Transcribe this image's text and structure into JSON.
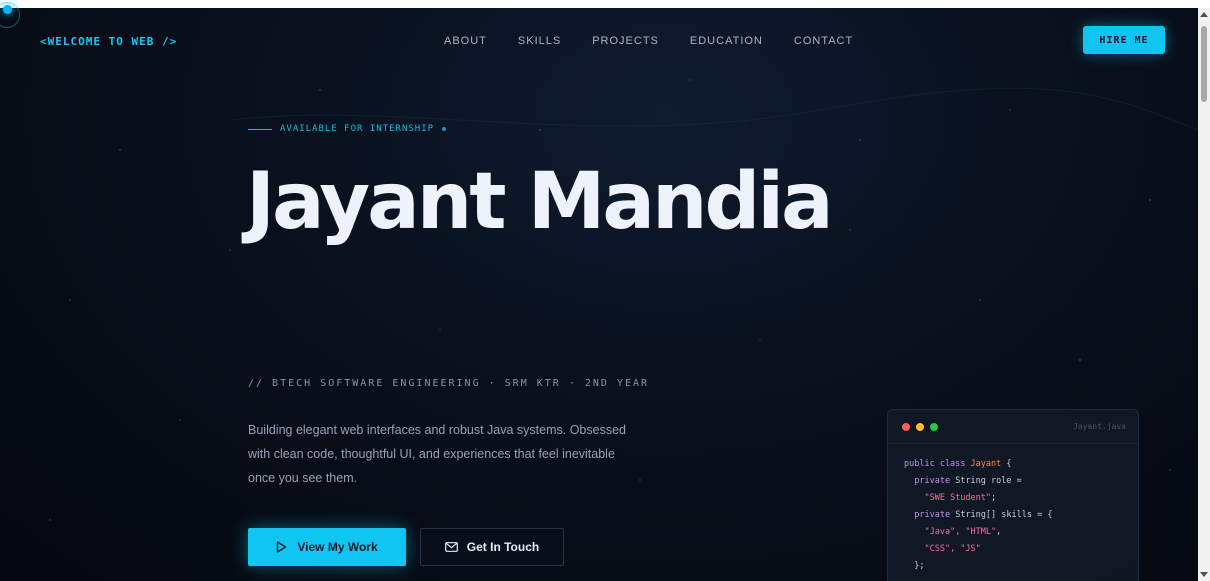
{
  "nav": {
    "logo": "<WELCOME TO WEB />",
    "links": [
      "ABOUT",
      "SKILLS",
      "PROJECTS",
      "EDUCATION",
      "CONTACT"
    ],
    "cta": "HIRE ME"
  },
  "hero": {
    "tag": "AVAILABLE FOR INTERNSHIP",
    "name": "Jayant Mandia",
    "subtitle": "// BTECH SOFTWARE ENGINEERING · SRM KTR · 2ND YEAR",
    "description": "Building elegant web interfaces and robust Java systems. Obsessed with clean code, thoughtful UI, and experiences that feel inevitable once you see them.",
    "primary_button": "View My Work",
    "secondary_button": "Get In Touch"
  },
  "code_card": {
    "filename": "Jayant.java",
    "lines": [
      {
        "keyword": "public class",
        "class_name": "Jayant",
        "text": "{"
      },
      {
        "keyword": "private",
        "text": "String role ="
      },
      {
        "string": "\"SWE Student\"",
        "text": ";"
      },
      {
        "keyword": "private",
        "text": "String[] skills = {"
      },
      {
        "string": "\"Java\", \"HTML\"",
        "text": ","
      },
      {
        "string": "\"CSS\", \"JS\"",
        "text": ""
      },
      {
        "text": "};"
      }
    ]
  },
  "icons": {
    "play": "play-icon",
    "mail": "mail-icon"
  },
  "colors": {
    "accent": "#0fc6f2",
    "background": "#070b16",
    "code_keyword": "#c792ea",
    "code_class": "#ff8a4c",
    "code_string": "#ff6b9d"
  }
}
